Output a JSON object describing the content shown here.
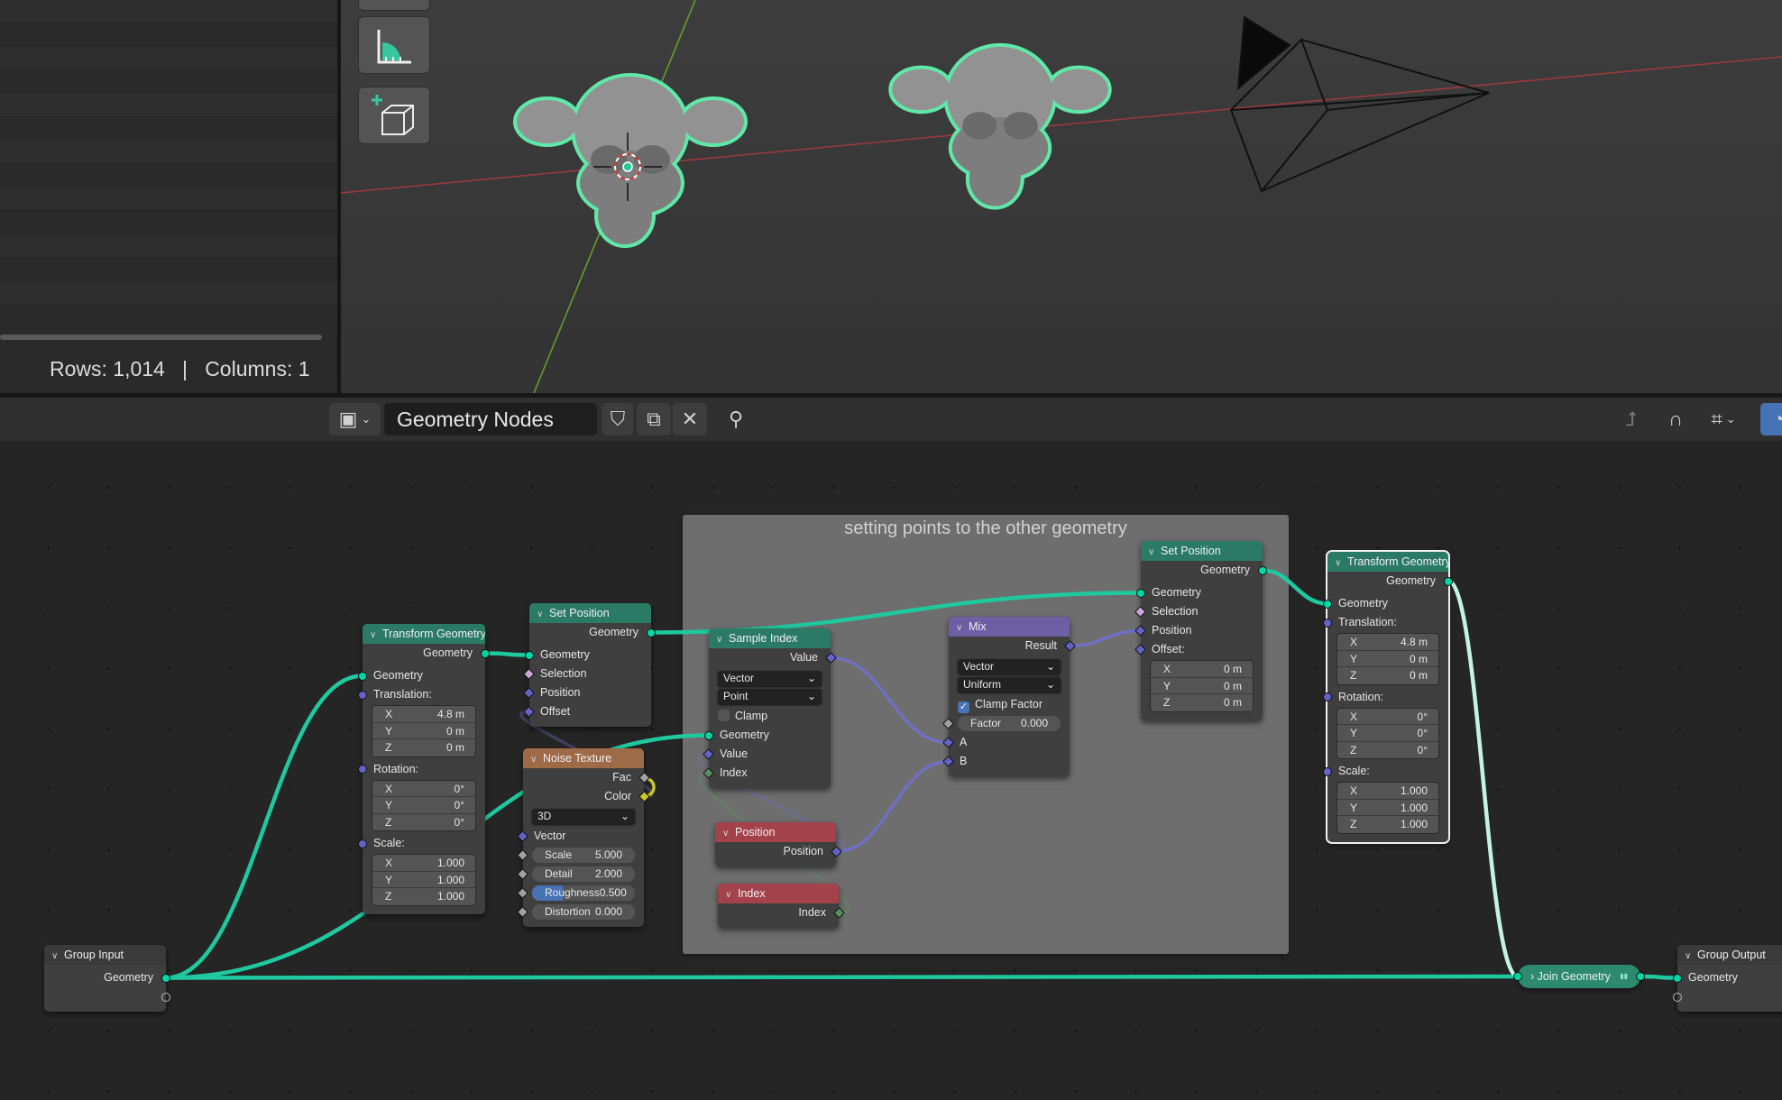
{
  "spreadsheet": {
    "rows_label": "Rows: 1,014",
    "separator": "|",
    "columns_label": "Columns: 1"
  },
  "viewport": {
    "toolbar": [
      "measure-tool",
      "add-cube-tool"
    ],
    "objects": [
      "suzanne-1",
      "suzanne-2",
      "camera"
    ],
    "outline_color": "#5fe8a8"
  },
  "header": {
    "editor_type_icon": "node-editor-icon",
    "tree_name": "Geometry Nodes",
    "icons": [
      "fake-user-shield-icon",
      "duplicate-icon",
      "close-icon",
      "pin-icon"
    ],
    "right_icons": [
      "parent-node-icon",
      "snap-magnet-icon",
      "snap-grid-icon",
      "overlay-icon"
    ]
  },
  "frame": {
    "label": "setting points to the other geometry"
  },
  "colors": {
    "geometry_header": "#2b7a66",
    "texture_header": "#9e6a48",
    "converter_header": "#6c5fa3",
    "input_header": "#a4424b",
    "group_header": "#3a3a3a",
    "geo": "#00d6a3",
    "vec": "#6363c7",
    "float": "#a1a1a1",
    "int": "#598c5c",
    "color": "#c7c729",
    "bool": "#cca6d6"
  },
  "nodes": [
    {
      "title": "Transform Geometry",
      "cat": "geometry_header",
      "rows": [
        {
          "t": "out",
          "label": "Geometry",
          "s": "geo",
          "sh": "c"
        },
        {
          "t": "in",
          "label": "Geometry",
          "s": "geo",
          "sh": "c",
          "gap": true
        },
        {
          "t": "in",
          "label": "Translation:",
          "s": "vec",
          "sh": "c"
        },
        {
          "t": "vec",
          "v": [
            [
              "X",
              "4.8 m"
            ],
            [
              "Y",
              "0 m"
            ],
            [
              "Z",
              "0 m"
            ]
          ]
        },
        {
          "t": "in",
          "label": "Rotation:",
          "s": "vec",
          "sh": "c"
        },
        {
          "t": "vec",
          "v": [
            [
              "X",
              "0°"
            ],
            [
              "Y",
              "0°"
            ],
            [
              "Z",
              "0°"
            ]
          ]
        },
        {
          "t": "in",
          "label": "Scale:",
          "s": "vec",
          "sh": "c"
        },
        {
          "t": "vec",
          "v": [
            [
              "X",
              "1.000"
            ],
            [
              "Y",
              "1.000"
            ],
            [
              "Z",
              "1.000"
            ]
          ]
        }
      ]
    },
    {
      "title": "Set Position",
      "cat": "geometry_header",
      "rows": [
        {
          "t": "out",
          "label": "Geometry",
          "s": "geo",
          "sh": "c"
        },
        {
          "t": "in",
          "label": "Geometry",
          "s": "geo",
          "sh": "c",
          "gap": true
        },
        {
          "t": "in",
          "label": "Selection",
          "s": "bool",
          "sh": "d"
        },
        {
          "t": "in",
          "label": "Position",
          "s": "vec",
          "sh": "d"
        },
        {
          "t": "in",
          "label": "Offset",
          "s": "vec",
          "sh": "d"
        }
      ]
    },
    {
      "title": "Noise Texture",
      "cat": "texture_header",
      "rows": [
        {
          "t": "out",
          "label": "Fac",
          "s": "float",
          "sh": "d"
        },
        {
          "t": "out",
          "label": "Color",
          "s": "color",
          "sh": "d"
        },
        {
          "t": "select",
          "value": "3D"
        },
        {
          "t": "in",
          "label": "Vector",
          "s": "vec",
          "sh": "d"
        },
        {
          "t": "slider",
          "label": "Scale",
          "value": "5.000",
          "s": "float",
          "sh": "d"
        },
        {
          "t": "slider",
          "label": "Detail",
          "value": "2.000",
          "s": "float",
          "sh": "d"
        },
        {
          "t": "slider",
          "label": "Roughness",
          "value": "0.500",
          "fill": 0.5,
          "s": "float",
          "sh": "d"
        },
        {
          "t": "slider",
          "label": "Distortion",
          "value": "0.000",
          "s": "float",
          "sh": "d"
        }
      ]
    },
    {
      "title": "Sample Index",
      "cat": "geometry_header",
      "rows": [
        {
          "t": "out",
          "label": "Value",
          "s": "vec",
          "sh": "d"
        },
        {
          "t": "select",
          "value": "Vector",
          "gap": true
        },
        {
          "t": "select",
          "value": "Point"
        },
        {
          "t": "check",
          "label": "Clamp",
          "checked": false
        },
        {
          "t": "in",
          "label": "Geometry",
          "s": "geo",
          "sh": "c"
        },
        {
          "t": "in",
          "label": "Value",
          "s": "vec",
          "sh": "d"
        },
        {
          "t": "in",
          "label": "Index",
          "s": "int",
          "sh": "d"
        }
      ]
    },
    {
      "title": "Position",
      "cat": "input_header",
      "rows": [
        {
          "t": "out",
          "label": "Position",
          "s": "vec",
          "sh": "d"
        }
      ]
    },
    {
      "title": "Index",
      "cat": "input_header",
      "rows": [
        {
          "t": "out",
          "label": "Index",
          "s": "int",
          "sh": "d"
        }
      ]
    },
    {
      "title": "Mix",
      "cat": "converter_header",
      "rows": [
        {
          "t": "out",
          "label": "Result",
          "s": "vec",
          "sh": "d"
        },
        {
          "t": "select",
          "value": "Vector",
          "gap": true
        },
        {
          "t": "select",
          "value": "Uniform"
        },
        {
          "t": "check",
          "label": "Clamp Factor",
          "checked": true
        },
        {
          "t": "slider",
          "label": "Factor",
          "value": "0.000",
          "s": "float",
          "sh": "d"
        },
        {
          "t": "in",
          "label": "A",
          "s": "vec",
          "sh": "d"
        },
        {
          "t": "in",
          "label": "B",
          "s": "vec",
          "sh": "d"
        }
      ]
    },
    {
      "title": "Set Position",
      "cat": "geometry_header",
      "rows": [
        {
          "t": "out",
          "label": "Geometry",
          "s": "geo",
          "sh": "c"
        },
        {
          "t": "in",
          "label": "Geometry",
          "s": "geo",
          "sh": "c",
          "gap": true
        },
        {
          "t": "in",
          "label": "Selection",
          "s": "bool",
          "sh": "d"
        },
        {
          "t": "in",
          "label": "Position",
          "s": "vec",
          "sh": "d"
        },
        {
          "t": "in",
          "label": "Offset:",
          "s": "vec",
          "sh": "d"
        },
        {
          "t": "vec",
          "v": [
            [
              "X",
              "0 m"
            ],
            [
              "Y",
              "0 m"
            ],
            [
              "Z",
              "0 m"
            ]
          ]
        }
      ]
    },
    {
      "title": "Transform Geometry",
      "cat": "geometry_header",
      "selected": true,
      "rows": [
        {
          "t": "out",
          "label": "Geometry",
          "s": "geo",
          "sh": "c"
        },
        {
          "t": "in",
          "label": "Geometry",
          "s": "geo",
          "sh": "c",
          "gap": true
        },
        {
          "t": "in",
          "label": "Translation:",
          "s": "vec",
          "sh": "c"
        },
        {
          "t": "vec",
          "v": [
            [
              "X",
              "4.8 m"
            ],
            [
              "Y",
              "0 m"
            ],
            [
              "Z",
              "0 m"
            ]
          ]
        },
        {
          "t": "in",
          "label": "Rotation:",
          "s": "vec",
          "sh": "c"
        },
        {
          "t": "vec",
          "v": [
            [
              "X",
              "0°"
            ],
            [
              "Y",
              "0°"
            ],
            [
              "Z",
              "0°"
            ]
          ]
        },
        {
          "t": "in",
          "label": "Scale:",
          "s": "vec",
          "sh": "c"
        },
        {
          "t": "vec",
          "v": [
            [
              "X",
              "1.000"
            ],
            [
              "Y",
              "1.000"
            ],
            [
              "Z",
              "1.000"
            ]
          ]
        }
      ]
    },
    {
      "title": "Group Input",
      "cat": "group_header",
      "rows": [
        {
          "t": "out",
          "label": "Geometry",
          "s": "geo",
          "sh": "c",
          "gap": true
        },
        {
          "t": "out",
          "label": "",
          "s": "empty",
          "sh": "c"
        }
      ]
    },
    {
      "title": "Join Geometry",
      "cat": "collapsed"
    },
    {
      "title": "Group Output",
      "cat": "group_header",
      "rows": [
        {
          "t": "in",
          "label": "Geometry",
          "s": "geo",
          "sh": "c",
          "gap": true
        },
        {
          "t": "in",
          "label": "",
          "s": "empty",
          "sh": "c"
        }
      ]
    }
  ],
  "links": [
    {
      "from": [
        9,
        0
      ],
      "to": [
        0,
        1
      ],
      "kind": "geo"
    },
    {
      "from": [
        0,
        0
      ],
      "to": [
        1,
        1
      ],
      "kind": "geo"
    },
    {
      "from": [
        1,
        0
      ],
      "to": [
        7,
        1
      ],
      "kind": "geo"
    },
    {
      "from": [
        9,
        0
      ],
      "to": [
        10,
        0
      ],
      "kind": "geo"
    },
    {
      "from": [
        9,
        0
      ],
      "to": [
        3,
        1
      ],
      "kind": "geo"
    },
    {
      "from": [
        7,
        0
      ],
      "to": [
        8,
        1
      ],
      "kind": "geo"
    },
    {
      "from": [
        8,
        0
      ],
      "to": [
        10,
        0
      ],
      "kind": "geo",
      "selected": true
    },
    {
      "from": [
        10,
        1
      ],
      "to": [
        11,
        0
      ],
      "kind": "geo"
    },
    {
      "from": [
        3,
        0
      ],
      "to": [
        6,
        2
      ],
      "kind": "vec"
    },
    {
      "from": [
        4,
        0
      ],
      "to": [
        6,
        3
      ],
      "kind": "vec"
    },
    {
      "from": [
        6,
        0
      ],
      "to": [
        7,
        3
      ],
      "kind": "vec"
    },
    {
      "from": [
        4,
        0
      ],
      "to": [
        3,
        2
      ],
      "kind": "vec",
      "muted": true
    },
    {
      "from": [
        5,
        0
      ],
      "to": [
        3,
        3
      ],
      "kind": "int",
      "muted": true
    },
    {
      "from": [
        2,
        1
      ],
      "to": [
        1,
        4
      ],
      "kind": "vec",
      "muted": true
    },
    {
      "from": [
        2,
        0
      ],
      "to": [
        2,
        1
      ],
      "kind": "color"
    }
  ]
}
